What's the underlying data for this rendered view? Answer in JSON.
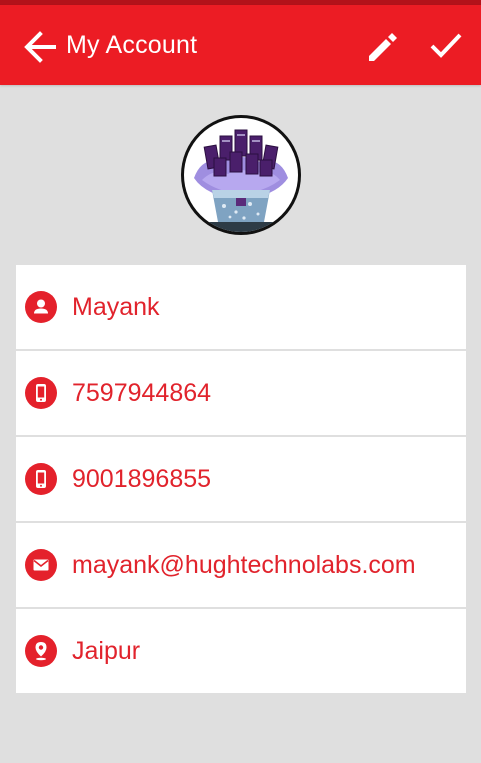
{
  "header": {
    "title": "My Account",
    "back_icon": "arrow-back-icon",
    "edit_icon": "pencil-icon",
    "confirm_icon": "check-icon"
  },
  "colors": {
    "accent": "#ec1c24",
    "text_accent": "#e1232c",
    "background": "#dfdfdf"
  },
  "profile": {
    "avatar_icon": "profile-photo"
  },
  "fields": [
    {
      "icon": "person-icon",
      "value": "Mayank"
    },
    {
      "icon": "mobile-phone-icon",
      "value": "7597944864"
    },
    {
      "icon": "mobile-phone-icon",
      "value": "9001896855"
    },
    {
      "icon": "email-icon",
      "value": "mayank@hughtechnolabs.com"
    },
    {
      "icon": "location-pin-icon",
      "value": "Jaipur"
    }
  ]
}
